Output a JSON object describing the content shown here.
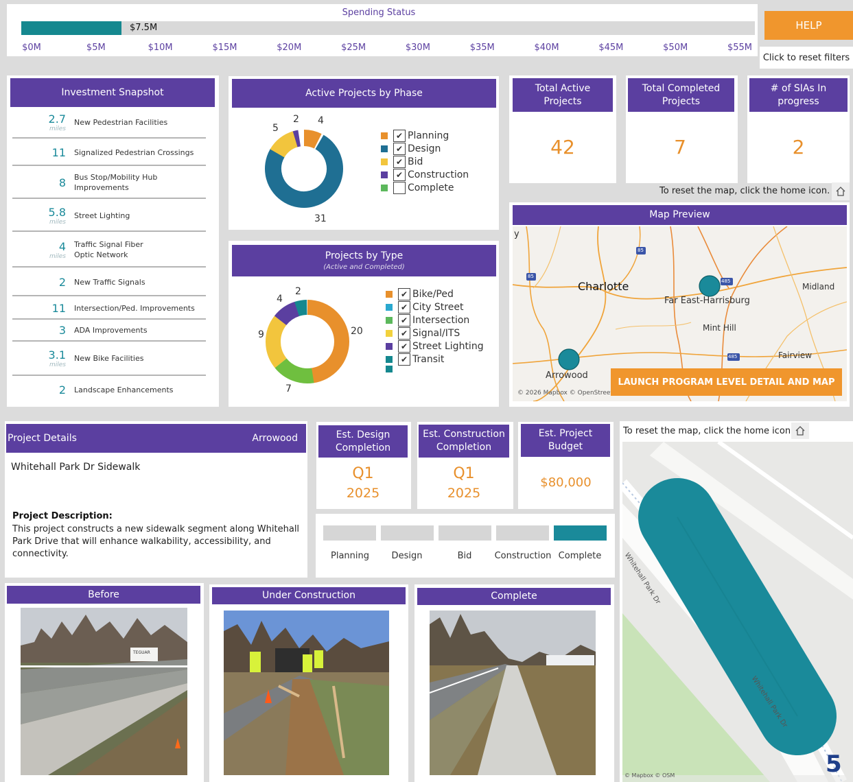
{
  "spending": {
    "title": "Spending Status",
    "value_label": "$7.5M",
    "value_m": 7.5,
    "max_m": 55,
    "ticks": [
      "$0M",
      "$5M",
      "$10M",
      "$15M",
      "$20M",
      "$25M",
      "$30M",
      "$35M",
      "$40M",
      "$45M",
      "$50M",
      "$55M"
    ]
  },
  "help": {
    "label": "HELP",
    "reset_filters": "Click to reset filters"
  },
  "snapshot": {
    "title": "Investment Snapshot",
    "items": [
      {
        "value": "2.7",
        "unit": "miles",
        "label": "New Pedestrian Facilities"
      },
      {
        "value": "11",
        "unit": "",
        "label": "Signalized Pedestrian Crossings"
      },
      {
        "value": "8",
        "unit": "",
        "label": "Bus Stop/Mobility Hub Improvements"
      },
      {
        "value": "5.8",
        "unit": "miles",
        "label": "Street Lighting"
      },
      {
        "value": "4",
        "unit": "miles",
        "label": "Traffic Signal Fiber Optic Network"
      },
      {
        "value": "2",
        "unit": "",
        "label": "New Traffic Signals"
      },
      {
        "value": "11",
        "unit": "",
        "label": "Intersection/Ped. Improvements"
      },
      {
        "value": "3",
        "unit": "",
        "label": "ADA Improvements"
      },
      {
        "value": "3.1",
        "unit": "miles",
        "label": "New Bike Facilities"
      },
      {
        "value": "2",
        "unit": "",
        "label": "Landscape Enhancements"
      }
    ]
  },
  "phase_chart": {
    "title": "Active Projects by Phase",
    "slice_labels": [
      "4",
      "31",
      "5",
      "2"
    ],
    "legend": [
      "Planning",
      "Design",
      "Bid",
      "Construction",
      "Complete"
    ],
    "checked": [
      true,
      true,
      true,
      true,
      false
    ],
    "colors": {
      "planning": "#e8902c",
      "design": "#1f6f93",
      "bid": "#f2c53d",
      "construction": "#5b3fa0",
      "complete": "#5cb85c"
    }
  },
  "type_chart": {
    "title": "Projects by Type",
    "subtitle": "(Active and Completed)",
    "slice_labels": [
      "20",
      "7",
      "9",
      "4",
      "2"
    ],
    "legend": [
      "Bike/Ped",
      "City Street",
      "Intersection",
      "Signal/ITS",
      "Street Lighting",
      "Transit"
    ],
    "legend_colors": [
      "#e8902c",
      "#2aa8cf",
      "#5cb85c",
      "#f2d13d",
      "#5b3fa0",
      "#15888f"
    ],
    "colors": {
      "bike_ped": "#e8902c",
      "intersection": "#6fbf3f",
      "signal_its": "#f2c53d",
      "transit": "#5b3fa0",
      "teal": "#15888f"
    }
  },
  "kpis": [
    {
      "title": "Total Active Projects",
      "value": "42"
    },
    {
      "title": "Total Completed Projects",
      "value": "7"
    },
    {
      "title": "# of SIAs In progress",
      "value": "2"
    }
  ],
  "reset_map_text": "To reset the map, click the home icon.",
  "map_preview": {
    "title": "Map Preview",
    "labels": {
      "charlotte": "Charlotte",
      "far_east": "Far East-Harrisburg",
      "midland": "Midland",
      "mint_hill": "Mint Hill",
      "fairview": "Fairview",
      "arrowood": "Arrowood",
      "y": "y",
      "i85a": "85",
      "i85b": "85",
      "i485a": "485",
      "i485b": "485"
    },
    "attribution": "© 2026 Mapbox © OpenStreetMap",
    "launch_button": "LAUNCH PROGRAM LEVEL DETAIL AND MAP"
  },
  "project": {
    "header": "Project Details",
    "location": "Arrowood",
    "name": "Whitehall Park Dr Sidewalk",
    "desc_heading": "Project Description:",
    "description": "This project constructs a new sidewalk segment along Whitehall Park Drive that will enhance walkability, accessibility, and connectivity."
  },
  "est": [
    {
      "title": "Est. Design Completion",
      "q": "Q1",
      "year": "2025"
    },
    {
      "title": "Est. Construction Completion",
      "q": "Q1",
      "year": "2025"
    },
    {
      "title": "Est. Project Budget",
      "value": "$80,000"
    }
  ],
  "phases": {
    "labels": [
      "Planning",
      "Design",
      "Bid",
      "Construction",
      "Complete"
    ],
    "current_index": 4,
    "active_color": "#1a8a9a"
  },
  "photos": [
    {
      "title": "Before",
      "sign": "TEGUAR"
    },
    {
      "title": "Under Construction"
    },
    {
      "title": "Complete"
    }
  ],
  "detail_map": {
    "road_label_1": "Whitehall Park Dr",
    "road_label_2": "Whitehall Park Dr",
    "attribution": "© Mapbox  © OSM",
    "page_number": "5"
  }
}
